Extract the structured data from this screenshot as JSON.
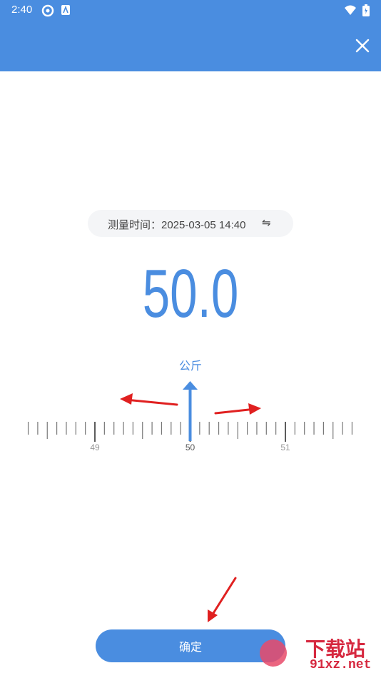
{
  "status_bar": {
    "time": "2:40"
  },
  "measure": {
    "time_label": "测量时间：2025-03-05  14:40",
    "value": "50.0",
    "unit": "公斤"
  },
  "ruler": {
    "min": 48.3,
    "max": 51.7,
    "step": 0.1,
    "selected": 50.0,
    "labels": [
      "49",
      "50",
      "51"
    ]
  },
  "actions": {
    "confirm_label": "确定"
  },
  "watermark": {
    "text": "下载站",
    "sub": "91xz.net"
  },
  "colors": {
    "accent": "#4a8de0",
    "annotation": "#e02020"
  }
}
